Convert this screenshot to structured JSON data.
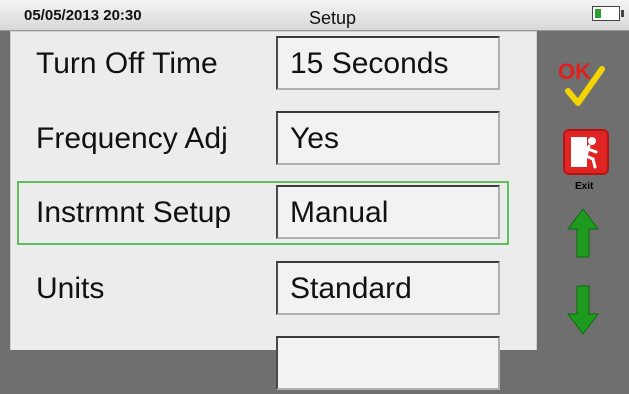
{
  "status": {
    "datetime": "05/05/2013 20:30",
    "title": "Setup"
  },
  "settings": [
    {
      "label": "Turn Off Time",
      "value": "15 Seconds"
    },
    {
      "label": "Frequency Adj",
      "value": "Yes"
    },
    {
      "label": "Instrmnt Setup",
      "value": "Manual"
    },
    {
      "label": "Units",
      "value": "Standard"
    }
  ],
  "actions": {
    "ok_label": "OK",
    "exit_label": "Exit"
  },
  "icons": {
    "battery": "battery-icon",
    "ok": "ok-checkmark-icon",
    "exit": "exit-running-man-icon",
    "up": "arrow-up-icon",
    "down": "arrow-down-icon"
  },
  "colors": {
    "selection": "#5fbf5f",
    "ok_red": "#e21e1e",
    "ok_check": "#f3d400",
    "exit_red": "#e02424",
    "arrow_green": "#1e9a1e"
  }
}
